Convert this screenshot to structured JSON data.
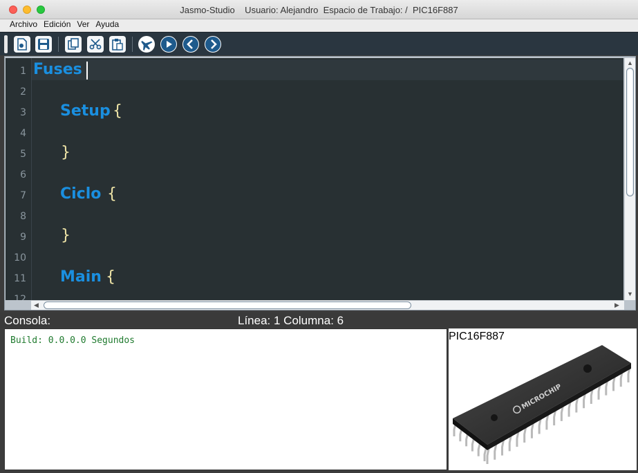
{
  "window": {
    "title": "Jasmo-Studio    Usuario: Alejandro  Espacio de Trabajo: /  PIC16F887"
  },
  "menu": {
    "items": [
      "Archivo",
      "Edición",
      "Ver",
      "Ayuda"
    ]
  },
  "toolbar": {
    "buttons": [
      {
        "name": "new-file-icon"
      },
      {
        "name": "save-icon"
      },
      {
        "name": "copy-icon"
      },
      {
        "name": "cut-icon"
      },
      {
        "name": "paste-icon"
      },
      {
        "name": "airplane-icon"
      },
      {
        "name": "play-icon"
      },
      {
        "name": "back-icon"
      },
      {
        "name": "forward-icon"
      }
    ]
  },
  "editor": {
    "line_numbers": [
      "1",
      "2",
      "3",
      "4",
      "5",
      "6",
      "7",
      "8",
      "9",
      "10",
      "11",
      "12"
    ],
    "lines": {
      "l1_keyword": "Fuses",
      "l3_keyword": "Setup",
      "l3_brace": "{",
      "l5_brace": "}",
      "l7_keyword": "Ciclo",
      "l7_brace": "{",
      "l9_brace": "}",
      "l11_keyword": "Main",
      "l11_brace": "{"
    },
    "colors": {
      "background": "#283033",
      "keyword": "#1a8fe0",
      "brace": "#f1e6a8"
    }
  },
  "status": {
    "console_label": "Consola:",
    "position": "Línea: 1 Columna: 6"
  },
  "console": {
    "output": "Build: 0.0.0.0 Segundos"
  },
  "chip": {
    "label": "PIC16F887",
    "brand_text": "MICROCHIP"
  }
}
